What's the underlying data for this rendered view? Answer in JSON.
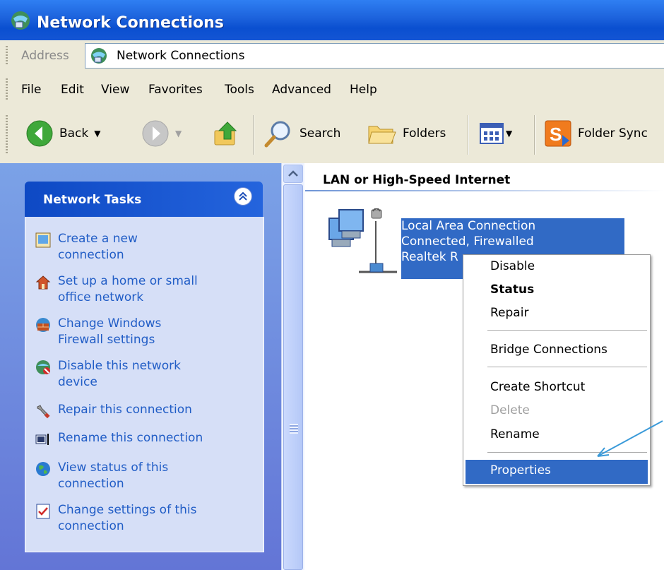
{
  "window": {
    "title": "Network Connections",
    "title_icon": "network-connections-icon"
  },
  "address_bar": {
    "label": "Address",
    "value": "Network Connections"
  },
  "menu": [
    "File",
    "Edit",
    "View",
    "Favorites",
    "Tools",
    "Advanced",
    "Help"
  ],
  "toolbar": {
    "back_label": "Back",
    "search_label": "Search",
    "folders_label": "Folders",
    "folder_sync_label": "Folder Sync"
  },
  "task_pane": {
    "title": "Network Tasks",
    "tasks": [
      {
        "label_line1": "Create a new",
        "label_line2": "connection",
        "icon": "new-connection-icon"
      },
      {
        "label_line1": "Set up a home or small",
        "label_line2": "office network",
        "icon": "home-network-icon"
      },
      {
        "label_line1": "Change Windows",
        "label_line2": "Firewall settings",
        "icon": "firewall-icon"
      },
      {
        "label_line1": "Disable this network",
        "label_line2": "device",
        "icon": "disable-network-icon"
      },
      {
        "label_line1": "Repair this connection",
        "label_line2": "",
        "icon": "repair-wrench-icon"
      },
      {
        "label_line1": "Rename this connection",
        "label_line2": "",
        "icon": "rename-icon"
      },
      {
        "label_line1": "View status of this",
        "label_line2": "connection",
        "icon": "status-globe-icon"
      },
      {
        "label_line1": "Change settings of this",
        "label_line2": "connection",
        "icon": "settings-check-icon"
      }
    ]
  },
  "content": {
    "group_header": "LAN or High-Speed Internet",
    "connection": {
      "name": "Local Area Connection",
      "status": "Connected, Firewalled",
      "device": "Realtek R"
    }
  },
  "context_menu": {
    "items": [
      {
        "label": "Disable",
        "bold": false,
        "disabled": false
      },
      {
        "label": "Status",
        "bold": true,
        "disabled": false
      },
      {
        "label": "Repair",
        "bold": false,
        "disabled": false
      },
      {
        "label": "Bridge Connections",
        "bold": false,
        "disabled": false
      },
      {
        "label": "Create Shortcut",
        "bold": false,
        "disabled": false
      },
      {
        "label": "Delete",
        "bold": false,
        "disabled": true
      },
      {
        "label": "Rename",
        "bold": false,
        "disabled": false
      },
      {
        "label": "Properties",
        "bold": false,
        "disabled": false,
        "highlighted": true
      }
    ]
  },
  "colors": {
    "titlebar": "#0a4fd0",
    "selection": "#316ac5",
    "task_link": "#215dc6",
    "annotation_arrow": "#3a9ad9"
  }
}
